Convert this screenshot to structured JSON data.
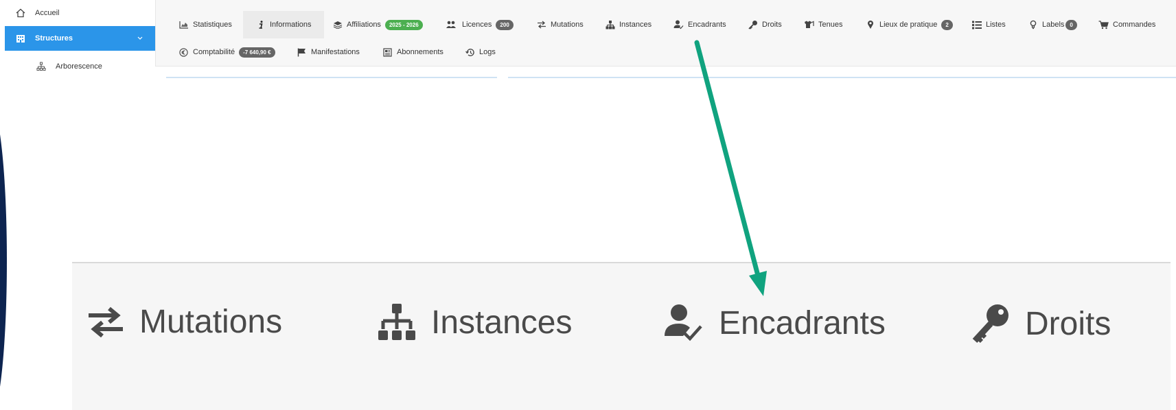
{
  "sidebar": {
    "accueil": "Accueil",
    "structures": "Structures",
    "arborescence": "Arborescence"
  },
  "tabs": {
    "statistiques": "Statistiques",
    "informations": "Informations",
    "affiliations": "Affiliations",
    "affiliations_badge": "2025 - 2026",
    "licences": "Licences",
    "licences_badge": "200",
    "mutations": "Mutations",
    "instances": "Instances",
    "encadrants": "Encadrants",
    "droits": "Droits",
    "tenues": "Tenues",
    "lieux": "Lieux de pratique",
    "lieux_badge": "2",
    "listes": "Listes",
    "labels": "Labels",
    "labels_badge": "0",
    "commandes": "Commandes",
    "comptabilite": "Comptabilité",
    "comptabilite_badge": "-7 640,90 €",
    "manifestations": "Manifestations",
    "abonnements": "Abonnements",
    "logs": "Logs"
  },
  "zoom": {
    "mutations": "Mutations",
    "instances": "Instances",
    "encadrants": "Encadrants",
    "droits": "Droits"
  },
  "colors": {
    "accent_blue": "#2b95e9",
    "badge_green": "#4caf50",
    "badge_grey": "#666666",
    "arrow_green": "#10a37f"
  }
}
